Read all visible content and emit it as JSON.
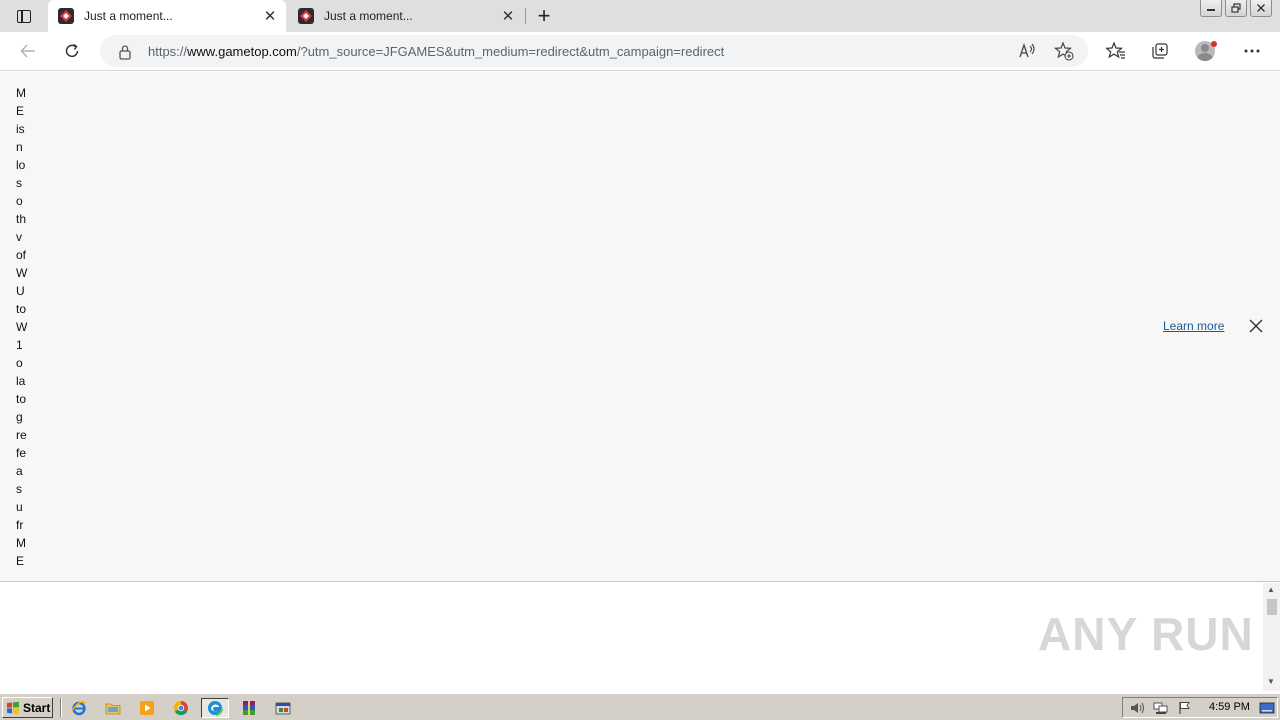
{
  "browser": {
    "tabs": [
      {
        "title": "Just a moment...",
        "active": true
      },
      {
        "title": "Just a moment...",
        "active": false
      }
    ],
    "address": {
      "scheme": "https://",
      "host": "www.gametop.com",
      "rest": "/?utm_source=JFGAMES&utm_medium=redirect&utm_campaign=redirect"
    }
  },
  "page": {
    "vertical_words": [
      "M",
      "E",
      "is",
      "n",
      "lo",
      "s",
      "o",
      "th",
      "v",
      "of",
      "W",
      "U",
      "to",
      "W",
      "1",
      "o",
      "la",
      "to",
      "g",
      "re",
      "fe",
      "a",
      "s",
      "u",
      "fr",
      "M",
      "E"
    ],
    "banner": {
      "learn_more": "Learn more"
    }
  },
  "watermark": {
    "text": "ANY RUN"
  },
  "taskbar": {
    "start_label": "Start",
    "clock": "4:59 PM"
  }
}
